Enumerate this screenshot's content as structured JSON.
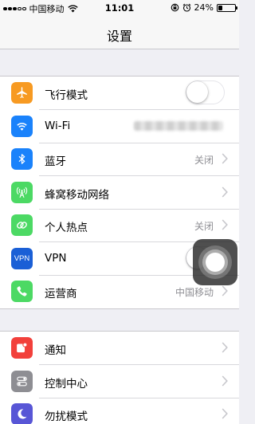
{
  "status_bar": {
    "carrier": "中国移动",
    "time": "11:01",
    "battery_text": "24%",
    "battery_level": 0.24
  },
  "nav": {
    "title": "设置"
  },
  "groups": [
    {
      "rows": [
        {
          "label": "飞行模式",
          "icon": "airplane-icon",
          "icon_color": "#f79a22",
          "control": "toggle",
          "toggle_on": false
        },
        {
          "label": "Wi-Fi",
          "icon": "wifi-icon",
          "icon_color": "#1a82fb",
          "control": "blurred-value"
        },
        {
          "label": "蓝牙",
          "icon": "bluetooth-icon",
          "icon_color": "#1a82fb",
          "value": "关闭"
        },
        {
          "label": "蜂窝移动网络",
          "icon": "cellular-antenna-icon",
          "icon_color": "#4cd964"
        },
        {
          "label": "个人热点",
          "icon": "hotspot-link-icon",
          "icon_color": "#4cd964",
          "value": "关闭"
        },
        {
          "label": "VPN",
          "icon": "vpn-icon",
          "icon_text": "VPN",
          "icon_color": "#1a5fd6",
          "control": "toggle",
          "toggle_on": false
        },
        {
          "label": "运营商",
          "icon": "phone-icon",
          "icon_color": "#4cd964",
          "value": "中国移动"
        }
      ]
    },
    {
      "rows": [
        {
          "label": "通知",
          "icon": "notifications-icon",
          "icon_color": "#f2403b"
        },
        {
          "label": "控制中心",
          "icon": "control-center-icon",
          "icon_color": "#8e8e93"
        },
        {
          "label": "勿扰模式",
          "icon": "moon-icon",
          "icon_color": "#5856d6"
        }
      ]
    }
  ]
}
